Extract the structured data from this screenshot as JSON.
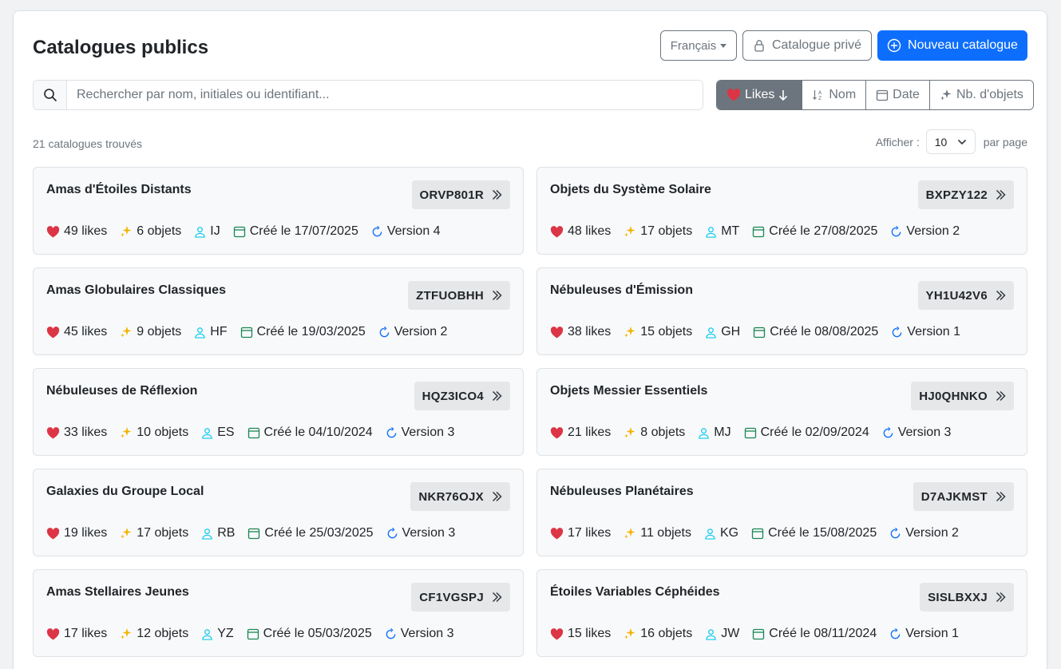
{
  "header": {
    "title": "Catalogues publics",
    "language_label": "Français",
    "private_label": "Catalogue privé",
    "new_label": "Nouveau catalogue"
  },
  "search": {
    "placeholder": "Rechercher par nom, initiales ou identifiant...",
    "value": ""
  },
  "sort": {
    "likes": "Likes",
    "name": "Nom",
    "date": "Date",
    "objects": "Nb. d'objets",
    "active": "likes"
  },
  "results": {
    "count_text": "21 catalogues trouvés",
    "show_label": "Afficher :",
    "per_page_value": "10",
    "per_page_suffix": "par page"
  },
  "colors": {
    "primary": "#0d6efd",
    "heart": "#dc3545",
    "sparkle": "#ffc107",
    "user": "#0dcaf0",
    "calendar": "#198754",
    "version": "#0d6efd"
  },
  "catalogues": [
    {
      "title": "Amas d'Étoiles Distants",
      "code": "ORVP801R",
      "likes": "49 likes",
      "objects": "6 objets",
      "initials": "IJ",
      "created": "Créé le 17/07/2025",
      "version": "Version 4"
    },
    {
      "title": "Objets du Système Solaire",
      "code": "BXPZY122",
      "likes": "48 likes",
      "objects": "17 objets",
      "initials": "MT",
      "created": "Créé le 27/08/2025",
      "version": "Version 2"
    },
    {
      "title": "Amas Globulaires Classiques",
      "code": "ZTFUOBHH",
      "likes": "45 likes",
      "objects": "9 objets",
      "initials": "HF",
      "created": "Créé le 19/03/2025",
      "version": "Version 2"
    },
    {
      "title": "Nébuleuses d'Émission",
      "code": "YH1U42V6",
      "likes": "38 likes",
      "objects": "15 objets",
      "initials": "GH",
      "created": "Créé le 08/08/2025",
      "version": "Version 1"
    },
    {
      "title": "Nébuleuses de Réflexion",
      "code": "HQZ3ICO4",
      "likes": "33 likes",
      "objects": "10 objets",
      "initials": "ES",
      "created": "Créé le 04/10/2024",
      "version": "Version 3"
    },
    {
      "title": "Objets Messier Essentiels",
      "code": "HJ0QHNKO",
      "likes": "21 likes",
      "objects": "8 objets",
      "initials": "MJ",
      "created": "Créé le 02/09/2024",
      "version": "Version 3"
    },
    {
      "title": "Galaxies du Groupe Local",
      "code": "NKR76OJX",
      "likes": "19 likes",
      "objects": "17 objets",
      "initials": "RB",
      "created": "Créé le 25/03/2025",
      "version": "Version 3"
    },
    {
      "title": "Nébuleuses Planétaires",
      "code": "D7AJKMST",
      "likes": "17 likes",
      "objects": "11 objets",
      "initials": "KG",
      "created": "Créé le 15/08/2025",
      "version": "Version 2"
    },
    {
      "title": "Amas Stellaires Jeunes",
      "code": "CF1VGSPJ",
      "likes": "17 likes",
      "objects": "12 objets",
      "initials": "YZ",
      "created": "Créé le 05/03/2025",
      "version": "Version 3"
    },
    {
      "title": "Étoiles Variables Céphéides",
      "code": "SISLBXXJ",
      "likes": "15 likes",
      "objects": "16 objets",
      "initials": "JW",
      "created": "Créé le 08/11/2024",
      "version": "Version 1"
    }
  ]
}
